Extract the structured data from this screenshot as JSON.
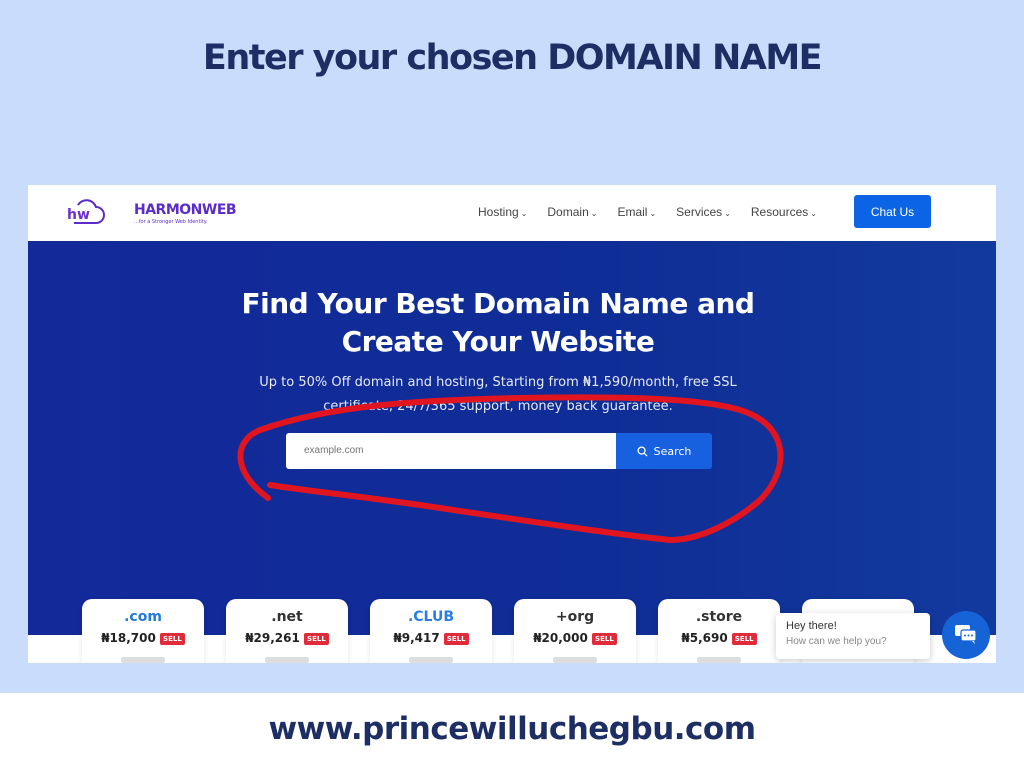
{
  "heading": "Enter your chosen DOMAIN NAME",
  "nav": {
    "brand": "HARMONWEB",
    "tagline": "...for a Stronger Web Identity.",
    "items": [
      "Hosting",
      "Domain",
      "Email",
      "Services",
      "Resources"
    ],
    "chat_us": "Chat Us"
  },
  "hero": {
    "title_line1": "Find Your Best Domain Name and",
    "title_line2": "Create Your Website",
    "subtitle": "Up to 50% Off domain and hosting, Starting from ₦1,590/month, free SSL",
    "subtitle_line2": "certificate, 24/7/365 support, money back guarantee.",
    "search_placeholder": "example.com",
    "search_label": "Search"
  },
  "tlds": [
    {
      "tld": ".com",
      "price": "₦18,700",
      "badge": "SELL",
      "color": "#1f7ad9"
    },
    {
      "tld": ".net",
      "price": "₦29,261",
      "badge": "SELL",
      "color": "#333333"
    },
    {
      "tld": ".CLUB",
      "price": "₦9,417",
      "badge": "SELL",
      "color": "#2a7de1"
    },
    {
      "tld": "+org",
      "price": "₦20,000",
      "badge": "SELL",
      "color": "#333333"
    },
    {
      "tld": ".store",
      "price": "₦5,690",
      "badge": "SELL",
      "color": "#333333"
    }
  ],
  "chat": {
    "greeting": "Hey there!",
    "prompt": "How can we help you?"
  },
  "footer": "www.princewilluchegbu.com",
  "colors": {
    "accent": "#0b63e5",
    "hero": "#13299a",
    "annotation": "#e0151f"
  }
}
